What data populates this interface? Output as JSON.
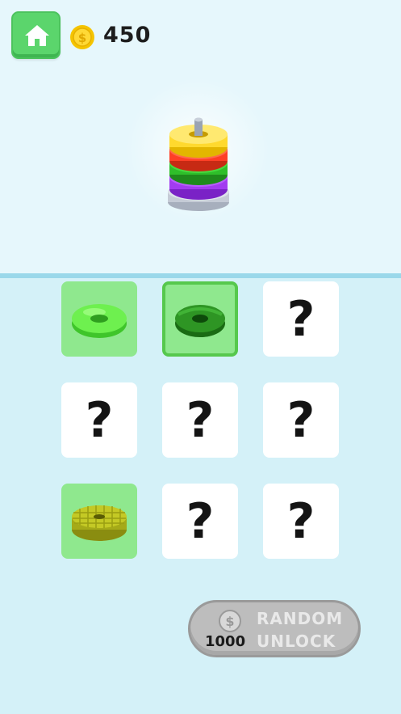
{
  "header": {
    "home_icon": "home-icon",
    "coin_icon": "coin-icon",
    "coins": "450"
  },
  "preview": {
    "rings": [
      "yellow",
      "red",
      "green",
      "purple"
    ],
    "colors": {
      "yellow": "#ffd92e",
      "red": "#ff3f26",
      "green": "#2fbf2a",
      "purple": "#a23cf0",
      "base": "#c5cbd6",
      "pole": "#9aa4b3"
    }
  },
  "grid": {
    "items": [
      {
        "state": "unlocked",
        "item": "light-green-donut",
        "label": ""
      },
      {
        "state": "selected",
        "item": "dark-green-donut",
        "label": ""
      },
      {
        "state": "locked",
        "label": "?"
      },
      {
        "state": "locked",
        "label": "?"
      },
      {
        "state": "locked",
        "label": "?"
      },
      {
        "state": "locked",
        "label": "?"
      },
      {
        "state": "unlocked",
        "item": "waffle-ring",
        "label": ""
      },
      {
        "state": "locked",
        "label": "?"
      },
      {
        "state": "locked",
        "label": "?"
      }
    ]
  },
  "random_unlock": {
    "price": "1000",
    "label_line1": "RANDOM",
    "label_line2": "UNLOCK",
    "icon": "dollar-coin-icon"
  }
}
